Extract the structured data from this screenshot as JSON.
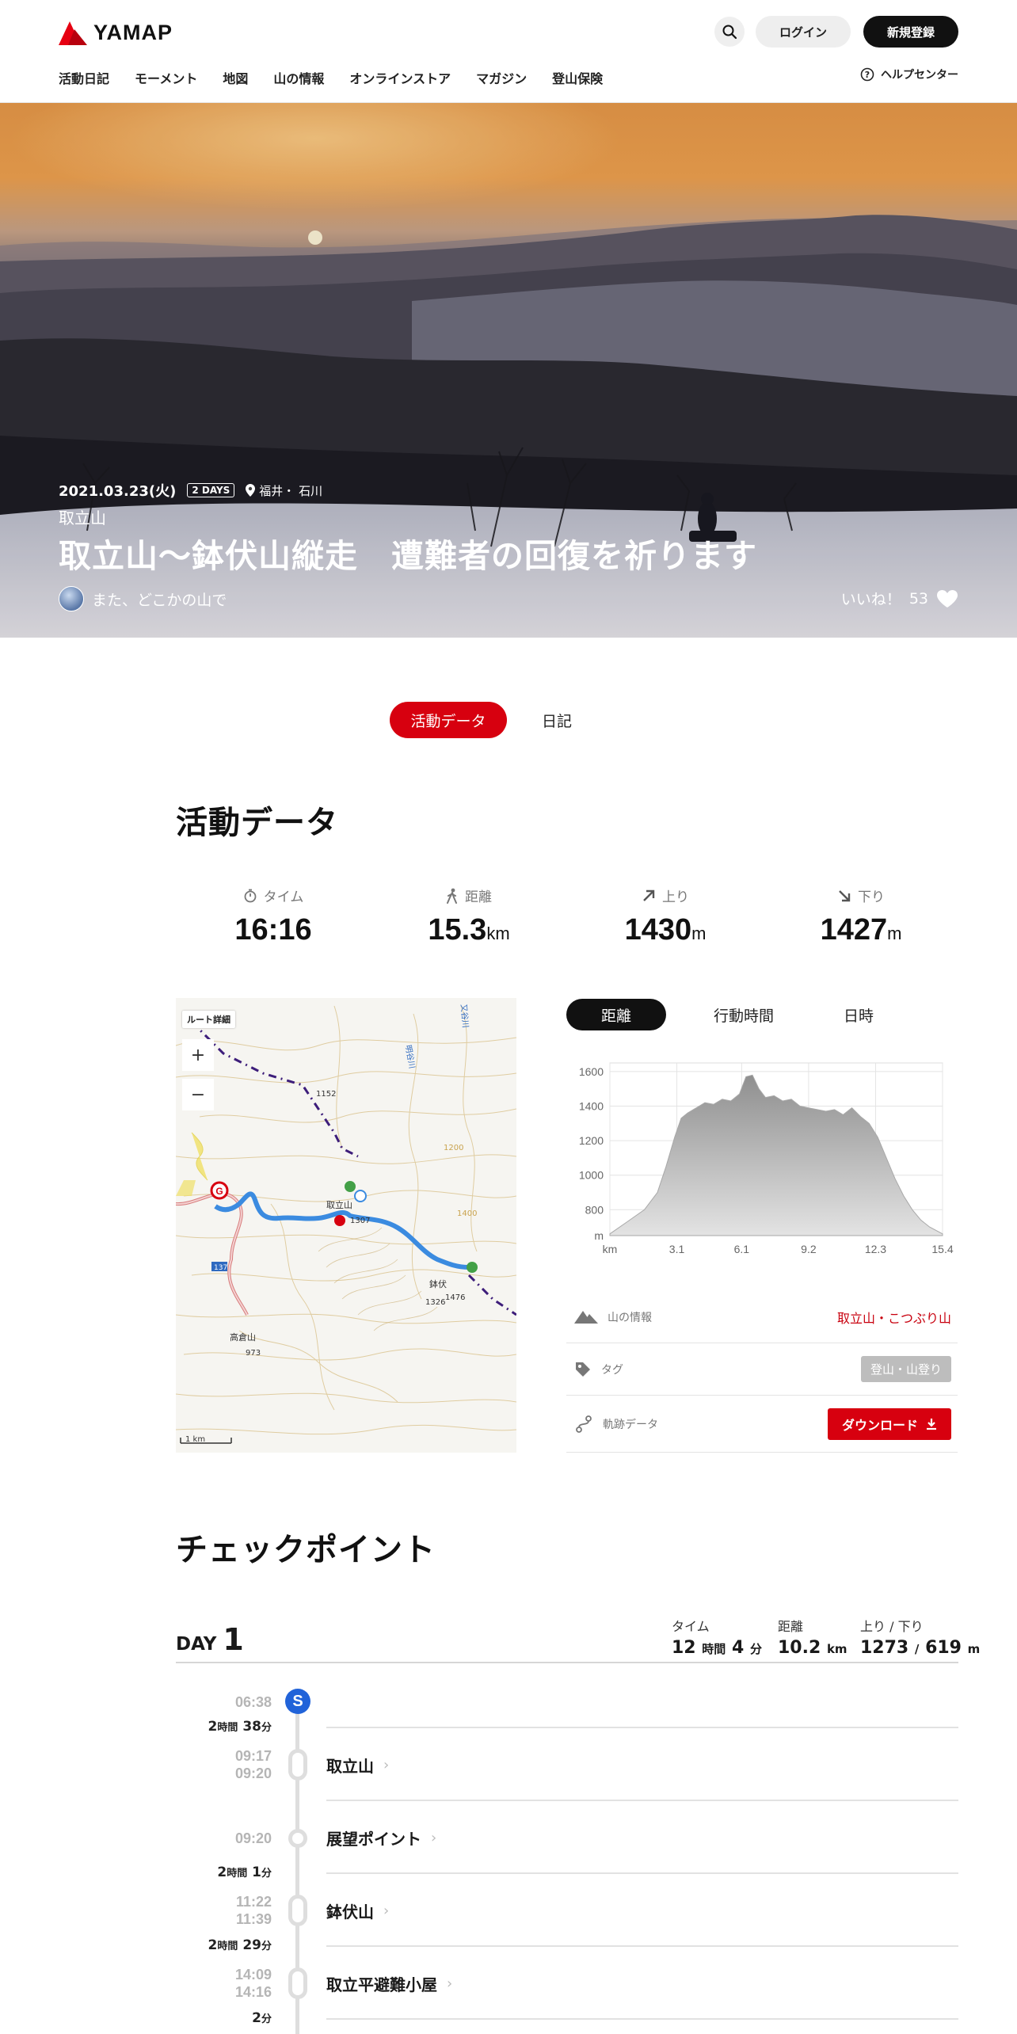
{
  "header": {
    "logo_text": "YAMAP",
    "login_label": "ログイン",
    "signup_label": "新規登録",
    "nav": [
      "活動日記",
      "モーメント",
      "地図",
      "山の情報",
      "オンラインストア",
      "マガジン",
      "登山保険"
    ],
    "help_label": "ヘルプセンター"
  },
  "hero": {
    "date": "2021.03.23(火)",
    "days_badge": "2 DAYS",
    "prefecture": "福井・ 石川",
    "mountain": "取立山",
    "title": "取立山～鉢伏山縦走　遭難者の回復を祈ります",
    "user_name": "また、どこかの山で",
    "like_label": "いいね！",
    "like_count": "53"
  },
  "tabs": {
    "active": "活動データ",
    "other": "日記"
  },
  "activity": {
    "title": "活動データ",
    "stats": [
      {
        "label": "タイム",
        "value": "16:16",
        "unit": ""
      },
      {
        "label": "距離",
        "value": "15.3",
        "unit": "km"
      },
      {
        "label": "上り",
        "value": "1430",
        "unit": "m"
      },
      {
        "label": "下り",
        "value": "1427",
        "unit": "m"
      }
    ]
  },
  "map": {
    "route_detail_label": "ルート詳細",
    "zoom_in": "+",
    "zoom_out": "−",
    "scale_label": "1 km",
    "labels": [
      "1152",
      "取立山",
      "1307",
      "鉢伏",
      "1326",
      "1476",
      "高倉山",
      "973",
      "1200",
      "1400",
      "137",
      "明谷川",
      "又谷川"
    ]
  },
  "chart_tabs": [
    "距離",
    "行動時間",
    "日時"
  ],
  "chart_data": {
    "type": "area",
    "xlabel": "km",
    "ylabel": "m",
    "x_ticks": [
      "km",
      "3.1",
      "6.1",
      "9.2",
      "12.3",
      "15.4"
    ],
    "y_ticks": [
      "m",
      "800",
      "1000",
      "1200",
      "1400",
      "1600"
    ],
    "ylim": [
      650,
      1650
    ],
    "xlim": [
      0,
      15.4
    ],
    "x": [
      0,
      0.8,
      1.6,
      2.2,
      2.6,
      3.0,
      3.3,
      3.6,
      4.0,
      4.4,
      4.8,
      5.2,
      5.6,
      6.0,
      6.3,
      6.6,
      6.9,
      7.2,
      7.6,
      8.0,
      8.4,
      8.8,
      9.2,
      9.6,
      10.0,
      10.4,
      10.8,
      11.2,
      11.6,
      12.0,
      12.4,
      12.8,
      13.2,
      13.6,
      14.0,
      14.4,
      14.8,
      15.4
    ],
    "values": [
      660,
      730,
      800,
      900,
      1050,
      1220,
      1330,
      1360,
      1390,
      1420,
      1410,
      1440,
      1430,
      1470,
      1570,
      1580,
      1500,
      1450,
      1460,
      1430,
      1440,
      1400,
      1390,
      1380,
      1370,
      1380,
      1350,
      1390,
      1340,
      1300,
      1220,
      1100,
      980,
      880,
      800,
      740,
      700,
      660
    ]
  },
  "info": {
    "mountain_label": "山の情報",
    "mountain_value": "取立山・こつぶり山",
    "tag_label": "タグ",
    "tag_value": "登山・山登り",
    "track_label": "軌跡データ",
    "download_label": "ダウンロード"
  },
  "checkpoints": {
    "title": "チェックポイント",
    "day_prefix": "DAY",
    "day_number": "1",
    "time_label": "タイム",
    "time_h": "12",
    "time_h_unit": "時間",
    "time_m": "4",
    "time_m_unit": "分",
    "dist_label": "距離",
    "dist_value": "10.2",
    "dist_unit": "km",
    "updown_label": "上り / 下り",
    "up_value": "1273",
    "down_value": "619",
    "updown_unit": "m",
    "start_time": "06:38",
    "start_icon": "S",
    "durations": [
      {
        "h": "2",
        "m": "38"
      },
      {
        "h": "2",
        "m": "1"
      },
      {
        "h": "2",
        "m": "29"
      },
      {
        "h": "",
        "m": "2"
      }
    ],
    "hour_unit": "時間",
    "min_unit": "分",
    "points": [
      {
        "name": "取立山",
        "arrive": "09:17",
        "depart": "09:20"
      },
      {
        "name": "展望ポイント",
        "arrive": "09:20",
        "depart": ""
      },
      {
        "name": "鉢伏山",
        "arrive": "11:22",
        "depart": "11:39"
      },
      {
        "name": "取立平避難小屋",
        "arrive": "14:09",
        "depart": "14:16"
      }
    ]
  }
}
